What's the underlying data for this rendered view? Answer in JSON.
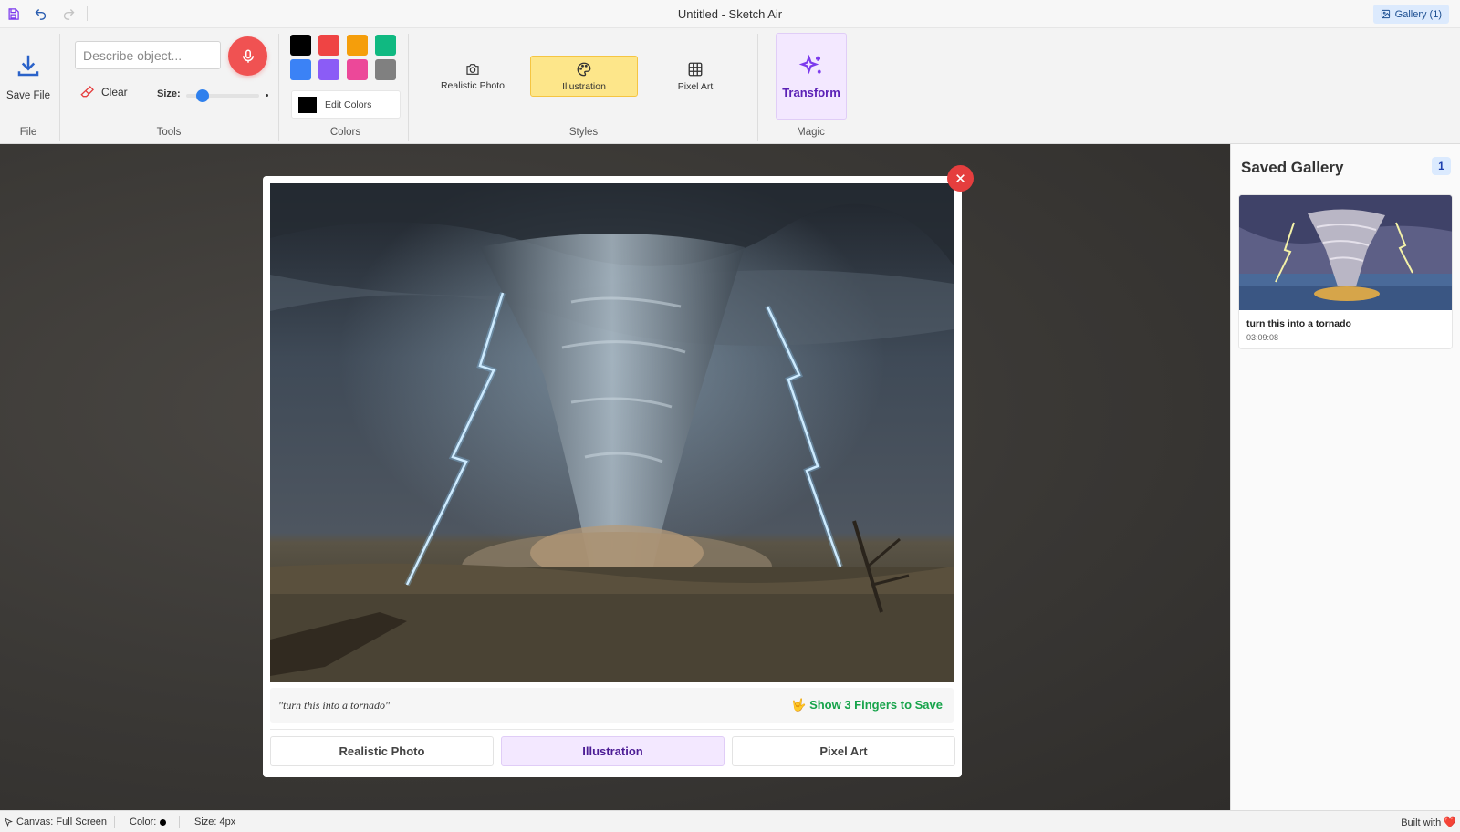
{
  "app": {
    "title": "Untitled - Sketch Air",
    "gallery_button": "Gallery (1)"
  },
  "ribbon": {
    "file": {
      "save_label": "Save File",
      "group": "File"
    },
    "tools": {
      "describe_placeholder": "Describe object...",
      "clear_label": "Clear",
      "size_label": "Size:",
      "size_value": 4,
      "group": "Tools"
    },
    "colors": {
      "swatches": [
        "#000000",
        "#ef4444",
        "#f59e0b",
        "#10b981",
        "#3b82f6",
        "#8b5cf6",
        "#ec4899",
        "#808080"
      ],
      "current": "#000000",
      "edit_label": "Edit Colors",
      "group": "Colors"
    },
    "styles": {
      "items": [
        {
          "label": "Realistic Photo",
          "icon": "camera-icon",
          "active": false
        },
        {
          "label": "Illustration",
          "icon": "palette-icon",
          "active": true
        },
        {
          "label": "Pixel Art",
          "icon": "grid-icon",
          "active": false
        }
      ],
      "group": "Styles"
    },
    "magic": {
      "transform_label": "Transform",
      "group": "Magic"
    }
  },
  "modal": {
    "caption": "\"turn this into a tornado\"",
    "save_hint": "🤟 Show 3 Fingers to Save",
    "style_buttons": [
      "Realistic Photo",
      "Illustration",
      "Pixel Art"
    ],
    "active_style": "Illustration"
  },
  "gallery": {
    "title": "Saved Gallery",
    "count": "1",
    "items": [
      {
        "title": "turn this into a tornado",
        "time": "03:09:08"
      }
    ]
  },
  "status": {
    "canvas": "Canvas: Full Screen",
    "color": "Color:",
    "size": "Size: 4px",
    "built": "Built with ❤️"
  }
}
